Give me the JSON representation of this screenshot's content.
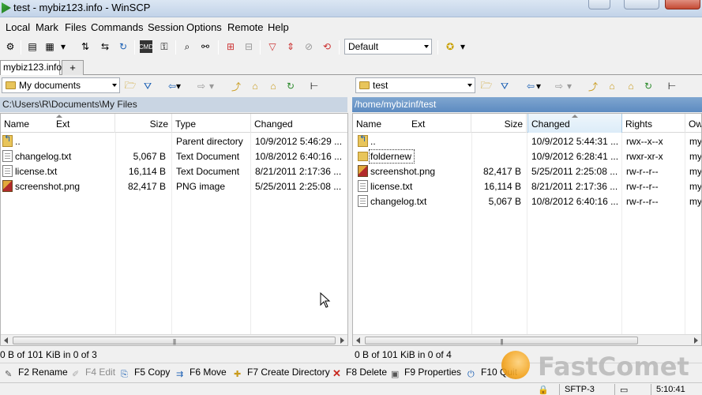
{
  "window": {
    "title": "test - mybiz123.info - WinSCP"
  },
  "menu": [
    "Local",
    "Mark",
    "Files",
    "Commands",
    "Session",
    "Options",
    "Remote",
    "Help"
  ],
  "toolbar": {
    "transfer_preset": "Default"
  },
  "tabs": {
    "session": "mybiz123.info",
    "new_tab": "+"
  },
  "left": {
    "dir": "My documents",
    "path": "C:\\Users\\R\\Documents\\My Files",
    "headers": {
      "name": "Name",
      "ext": "Ext",
      "size": "Size",
      "type": "Type",
      "changed": "Changed"
    },
    "rows": [
      {
        "name": "..",
        "size": "",
        "type": "Parent directory",
        "changed": "10/9/2012  5:46:29 ..."
      },
      {
        "name": "changelog.txt",
        "size": "5,067 B",
        "type": "Text Document",
        "changed": "10/8/2012  6:40:16 ..."
      },
      {
        "name": "license.txt",
        "size": "16,114 B",
        "type": "Text Document",
        "changed": "8/21/2011  2:17:36 ..."
      },
      {
        "name": "screenshot.png",
        "size": "82,417 B",
        "type": "PNG image",
        "changed": "5/25/2011  2:25:08 ..."
      }
    ],
    "status": "0 B of 101 KiB in 0 of 3"
  },
  "right": {
    "dir": "test",
    "path": "/home/mybizinf/test",
    "headers": {
      "name": "Name",
      "ext": "Ext",
      "size": "Size",
      "changed": "Changed",
      "rights": "Rights",
      "owner": "Ow"
    },
    "rows": [
      {
        "name": "..",
        "size": "",
        "changed": "10/9/2012 5:44:31 ...",
        "rights": "rwx--x--x",
        "owner": "my"
      },
      {
        "name": "foldernew",
        "size": "",
        "changed": "10/9/2012 6:28:41 ...",
        "rights": "rwxr-xr-x",
        "owner": "my"
      },
      {
        "name": "screenshot.png",
        "size": "82,417 B",
        "changed": "5/25/2011 2:25:08 ...",
        "rights": "rw-r--r--",
        "owner": "my"
      },
      {
        "name": "license.txt",
        "size": "16,114 B",
        "changed": "8/21/2011 2:17:36 ...",
        "rights": "rw-r--r--",
        "owner": "my"
      },
      {
        "name": "changelog.txt",
        "size": "5,067 B",
        "changed": "10/8/2012 6:40:16 ...",
        "rights": "rw-r--r--",
        "owner": "my"
      }
    ],
    "status": "0 B of 101 KiB in 0 of 4"
  },
  "commands": [
    {
      "key": "F2",
      "label": "Rename"
    },
    {
      "key": "F4",
      "label": "Edit"
    },
    {
      "key": "F5",
      "label": "Copy"
    },
    {
      "key": "F6",
      "label": "Move"
    },
    {
      "key": "F7",
      "label": "Create Directory"
    },
    {
      "key": "F8",
      "label": "Delete"
    },
    {
      "key": "F9",
      "label": "Properties"
    },
    {
      "key": "F10",
      "label": "Quit"
    }
  ],
  "statusbar": {
    "protocol": "SFTP-3",
    "time": "5:10:41"
  },
  "watermark": {
    "brand": "FastComet"
  },
  "colors": {
    "path_active": "#5d8bc1",
    "path_inactive": "#c9d5e3",
    "folder": "#e8c55b"
  }
}
